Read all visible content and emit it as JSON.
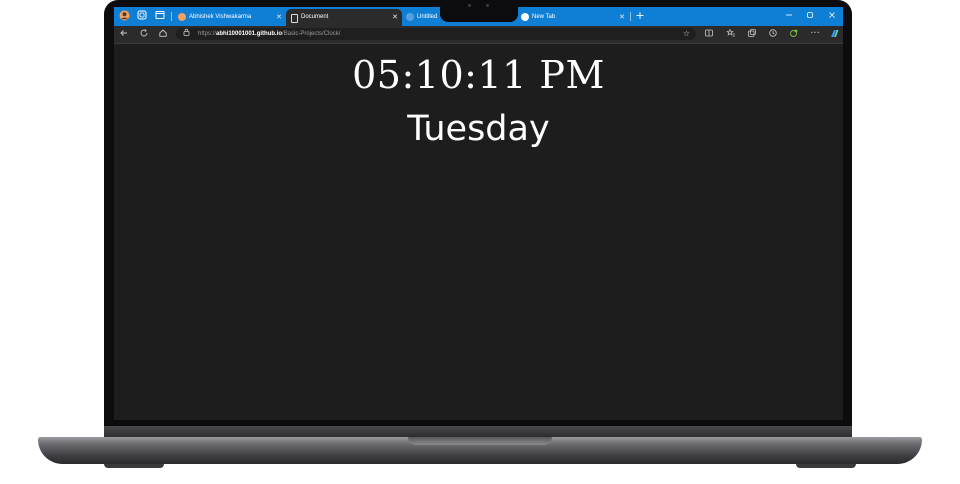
{
  "browser": {
    "tabs": [
      {
        "label": "Abhishek Vishwakarma",
        "active": false
      },
      {
        "label": "Document",
        "active": true
      },
      {
        "label": "Untitled",
        "active": false
      },
      {
        "label": "New Tab",
        "active": false
      }
    ],
    "new_tab_label": "+",
    "window_controls": [
      "minimize-icon",
      "restore-icon",
      "close-icon"
    ],
    "address": {
      "scheme": "https://",
      "host": "abhi10001001.github.io",
      "path": "/Basic-Projects/Clock/"
    },
    "toolbar_icons": [
      "star-icon",
      "split-screen-icon",
      "favorites-icon",
      "collections-icon",
      "history-icon",
      "extensions-icon",
      "more-icon",
      "copilot-icon"
    ]
  },
  "page": {
    "time": "05:10:11 PM",
    "day": "Tuesday"
  },
  "colors": {
    "tabbar": "#0f7fd6",
    "page_background": "#1d1d1d",
    "text": "#ffffff"
  }
}
